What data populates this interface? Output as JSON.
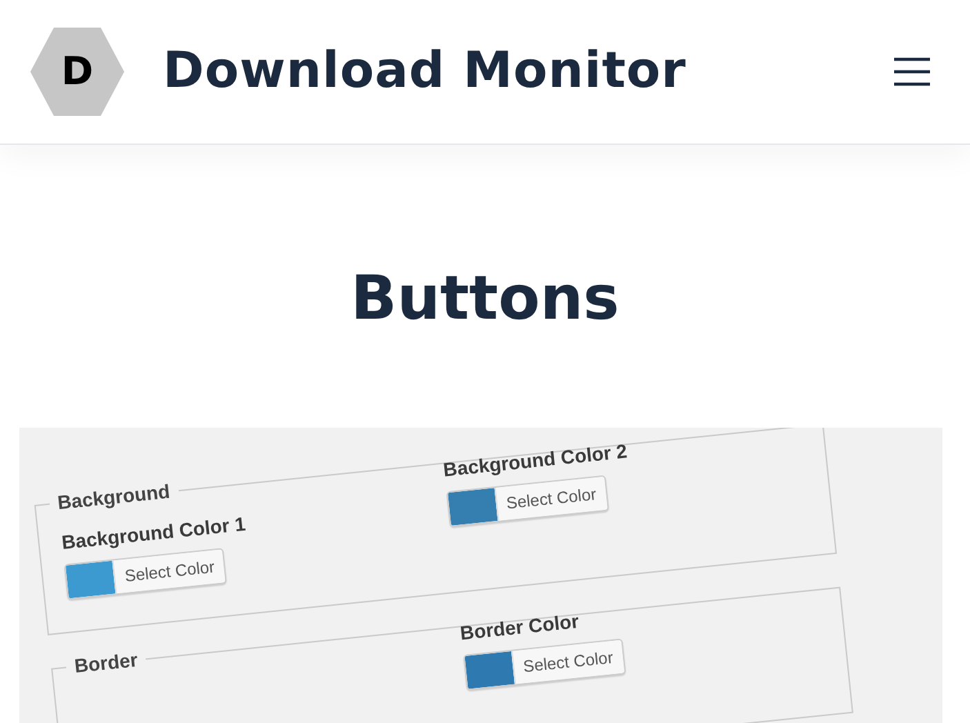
{
  "header": {
    "logo_letter": "D",
    "site_title": "Download Monitor"
  },
  "page_title": "Buttons",
  "screenshot": {
    "fieldsets": [
      {
        "legend": "Background",
        "left": {
          "label": "Background Color 1",
          "color": "#3d9ad1",
          "button": "Select Color"
        },
        "right": {
          "label": "Background Color 2",
          "color": "#347eb0",
          "button": "Select Color"
        }
      },
      {
        "legend": "Border",
        "right": {
          "label": "Border Color",
          "color": "#2e7ab0",
          "button": "Select Color"
        }
      }
    ]
  }
}
